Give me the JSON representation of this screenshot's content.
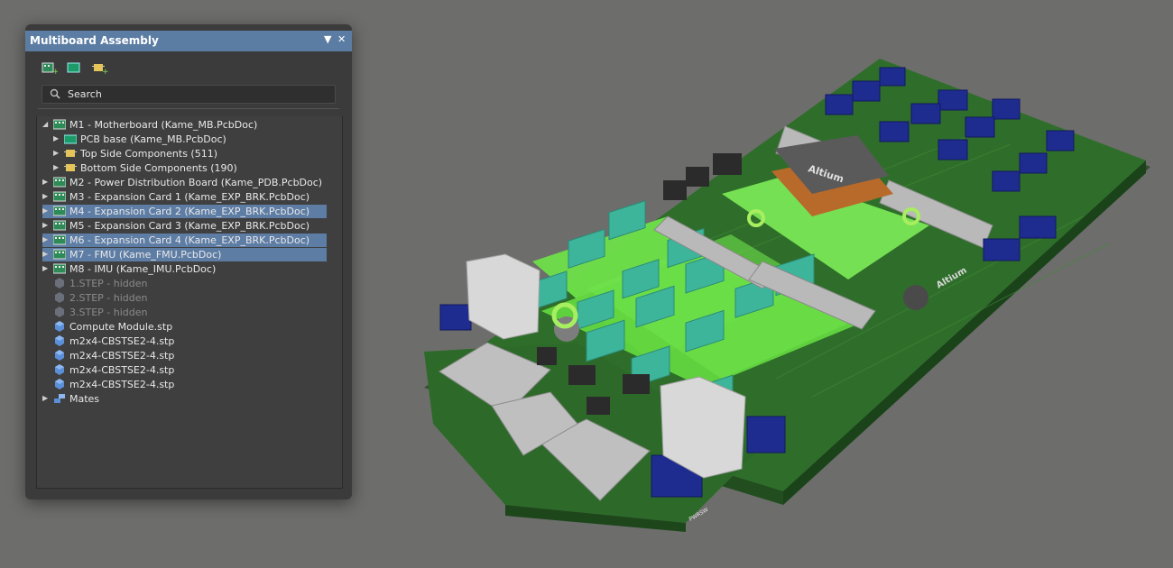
{
  "panel": {
    "title": "Multiboard Assembly",
    "menu_glyph": "▼",
    "close_glyph": "✕",
    "toolbar": [
      {
        "icon": "insert-board-icon"
      },
      {
        "icon": "pcb-board-icon"
      },
      {
        "icon": "add-component-icon"
      }
    ],
    "search": {
      "placeholder": "Search",
      "value": ""
    }
  },
  "tree": {
    "m1": {
      "label": "M1 - Motherboard (Kame_MB.PcbDoc)",
      "expanded": true
    },
    "m1_pcb_base": "PCB base (Kame_MB.PcbDoc)",
    "m1_top": "Top Side Components (511)",
    "m1_bottom": "Bottom Side Components (190)",
    "m2": "M2 - Power Distribution Board (Kame_PDB.PcbDoc)",
    "m3": "M3 - Expansion Card 1 (Kame_EXP_BRK.PcbDoc)",
    "m4": "M4 - Expansion Card 2 (Kame_EXP_BRK.PcbDoc)",
    "m5": "M5 - Expansion Card 3 (Kame_EXP_BRK.PcbDoc)",
    "m6": "M6 - Expansion Card 4 (Kame_EXP_BRK.PcbDoc)",
    "m7": "M7 - FMU (Kame_FMU.PcbDoc)",
    "m8": "M8 - IMU (Kame_IMU.PcbDoc)",
    "step1": "1.STEP - hidden",
    "step2": "2.STEP - hidden",
    "step3": "3.STEP - hidden",
    "compute": "Compute Module.stp",
    "m2x4_1": "m2x4-CBSTSE2-4.stp",
    "m2x4_2": "m2x4-CBSTSE2-4.stp",
    "m2x4_3": "m2x4-CBSTSE2-4.stp",
    "m2x4_4": "m2x4-CBSTSE2-4.stp",
    "mates": "Mates",
    "selected_rows": [
      "m4",
      "m6",
      "m7"
    ]
  },
  "colors": {
    "titlebar": "#5c7da3",
    "selection": "#5e7da5",
    "board_green": "#2f6e2a",
    "highlight_green": "#6fe04a",
    "connector_blue": "#1f2c8f",
    "viewport_bg": "#6d6d6b"
  },
  "viewport": {
    "silkscreen": {
      "logo1": "Altium",
      "logo2": "Altium",
      "pwrsw": "PWRSW"
    }
  }
}
